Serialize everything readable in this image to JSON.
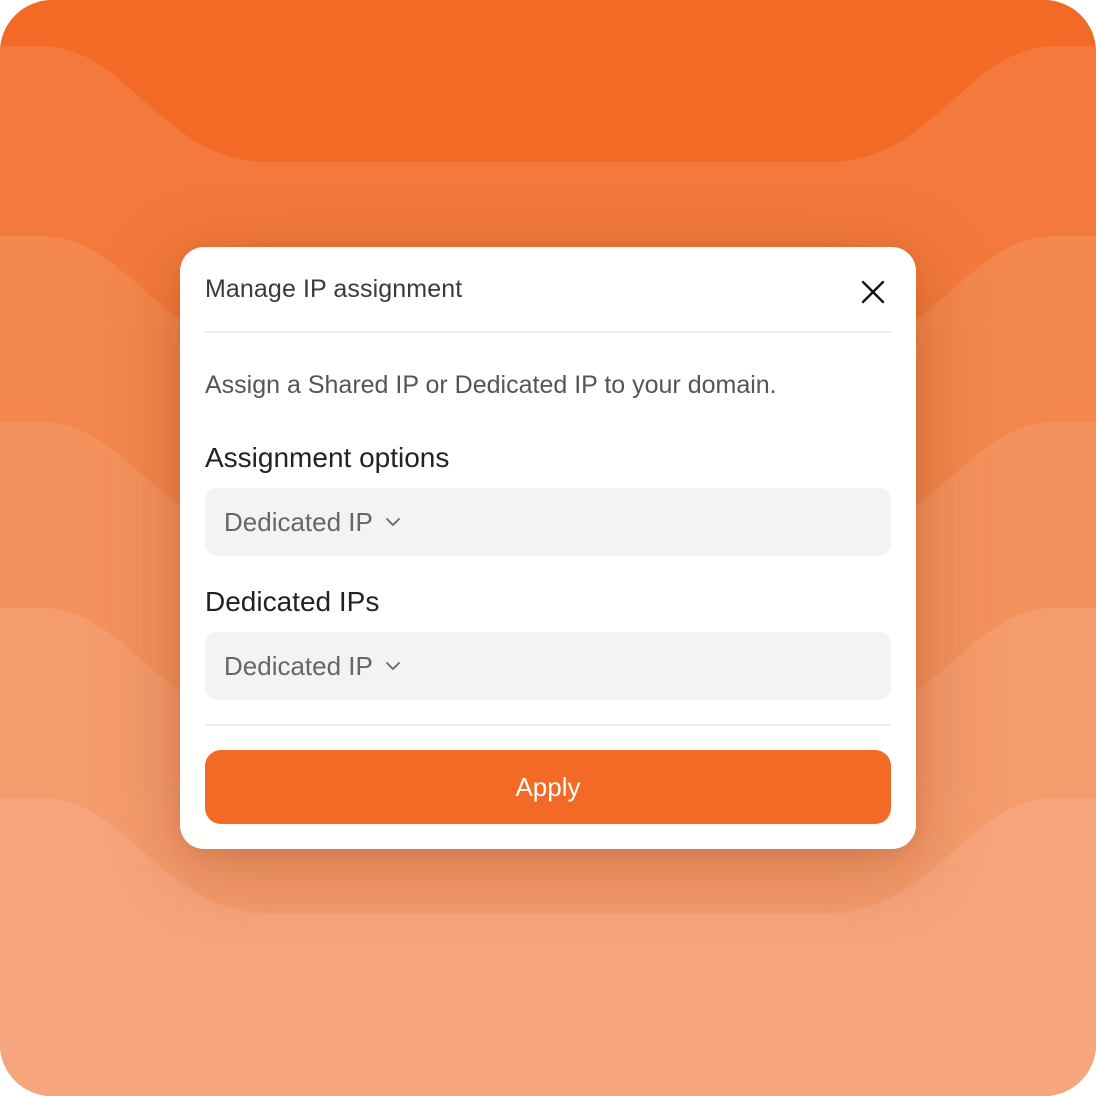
{
  "dialog": {
    "title": "Manage IP assignment",
    "close_icon": "close-icon",
    "description": "Assign a Shared IP or Dedicated IP to your domain.",
    "assignment_options": {
      "label": "Assignment options",
      "selected": "Dedicated IP",
      "icon": "chevron-down-icon"
    },
    "dedicated_ips": {
      "label": "Dedicated IPs",
      "selected": "Dedicated IP",
      "icon": "chevron-down-icon"
    },
    "apply_label": "Apply"
  },
  "colors": {
    "accent": "#f36a26",
    "background_light": "#f6a57d",
    "field_bg": "#f4f3f2"
  }
}
